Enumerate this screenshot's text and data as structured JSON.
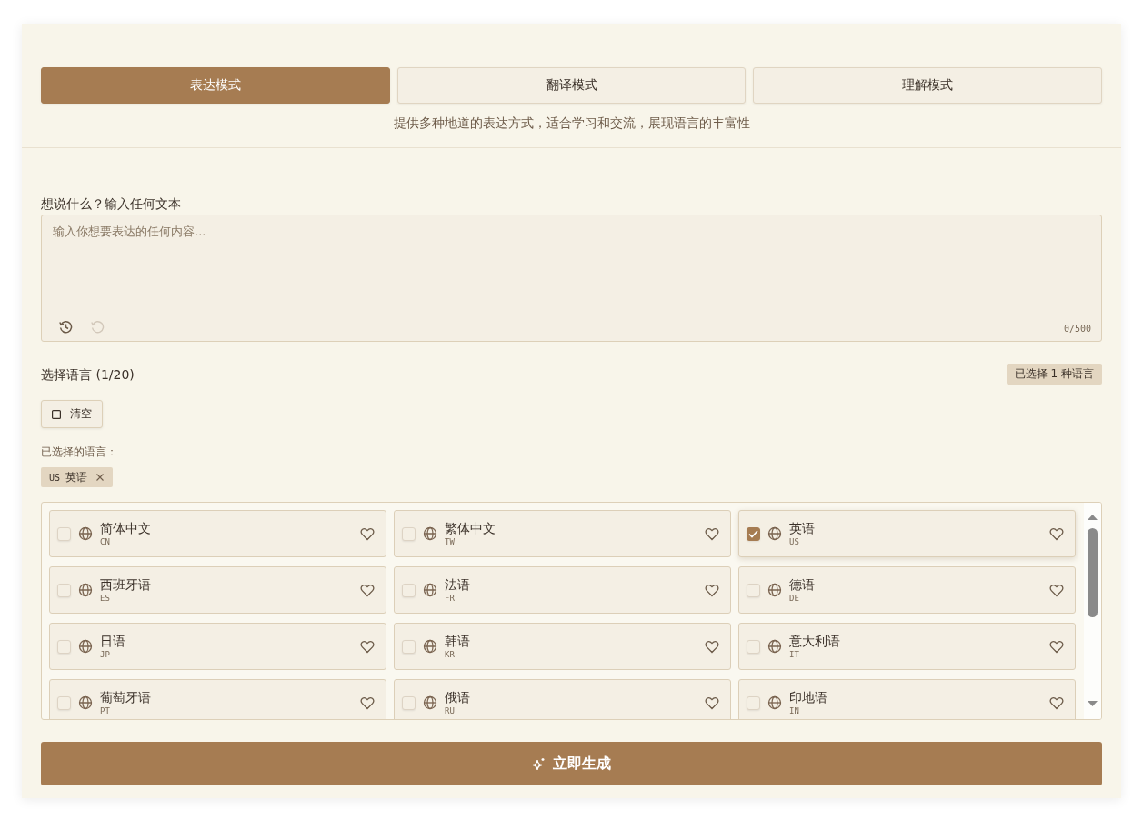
{
  "tabs": [
    {
      "label": "表达模式",
      "selected": true
    },
    {
      "label": "翻译模式",
      "selected": false
    },
    {
      "label": "理解模式",
      "selected": false
    }
  ],
  "mode_description": "提供多种地道的表达方式，适合学习和交流，展现语言的丰富性",
  "input": {
    "label": "想说什么？输入任何文本",
    "placeholder": "输入你想要表达的任何内容...",
    "counter": "0/500",
    "actions": [
      {
        "kind": "history",
        "disabled": false
      },
      {
        "kind": "undo",
        "disabled": true
      }
    ]
  },
  "language_section": {
    "title": "选择语言 (1/20)",
    "selected_count": "已选择 1 种语言",
    "clear_button": "清空",
    "selected_label": "已选择的语言：",
    "selected_chips": [
      {
        "code": "US",
        "name": "英语"
      }
    ]
  },
  "languages": [
    {
      "name": "简体中文",
      "code": "CN",
      "checked": false
    },
    {
      "name": "繁体中文",
      "code": "TW",
      "checked": false
    },
    {
      "name": "英语",
      "code": "US",
      "checked": true
    },
    {
      "name": "西班牙语",
      "code": "ES",
      "checked": false
    },
    {
      "name": "法语",
      "code": "FR",
      "checked": false
    },
    {
      "name": "德语",
      "code": "DE",
      "checked": false
    },
    {
      "name": "日语",
      "code": "JP",
      "checked": false
    },
    {
      "name": "韩语",
      "code": "KR",
      "checked": false
    },
    {
      "name": "意大利语",
      "code": "IT",
      "checked": false
    },
    {
      "name": "葡萄牙语",
      "code": "PT",
      "checked": false
    },
    {
      "name": "俄语",
      "code": "RU",
      "checked": false
    },
    {
      "name": "印地语",
      "code": "IN",
      "checked": false
    }
  ],
  "generate_button": "立即生成"
}
